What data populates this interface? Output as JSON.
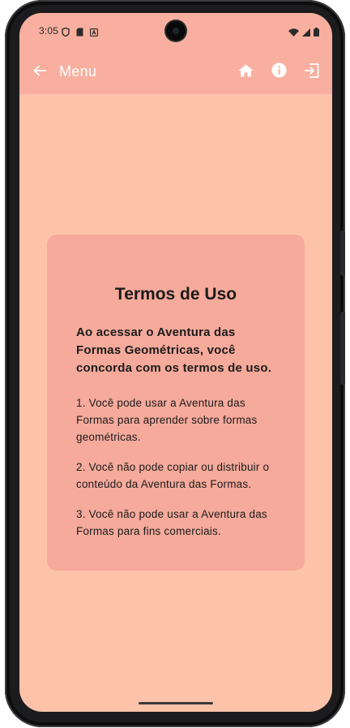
{
  "status_bar": {
    "time": "3:05",
    "left_icons": [
      "shield-icon",
      "sd-card-icon",
      "a-badge-icon"
    ],
    "right_icons": [
      "wifi-icon",
      "signal-icon",
      "battery-icon"
    ]
  },
  "app_bar": {
    "title": "Menu",
    "back_icon": "arrow-back-icon",
    "actions": [
      "home-icon",
      "info-icon",
      "logout-icon"
    ],
    "background": "#f8afa0",
    "foreground": "#ffffff"
  },
  "terms": {
    "title": "Termos de Uso",
    "intro": "Ao acessar o Aventura das Formas Geométricas, você concorda com os termos de uso.",
    "items": [
      "1. Você pode usar a Aventura das Formas para aprender sobre formas geométricas.",
      "2. Você não pode copiar ou distribuir o conteúdo da Aventura das Formas.",
      "3. Você não pode usar a Aventura das Formas para fins comerciais."
    ],
    "card_color": "#f6aa9b"
  },
  "screen_background": "#fdc3aa"
}
